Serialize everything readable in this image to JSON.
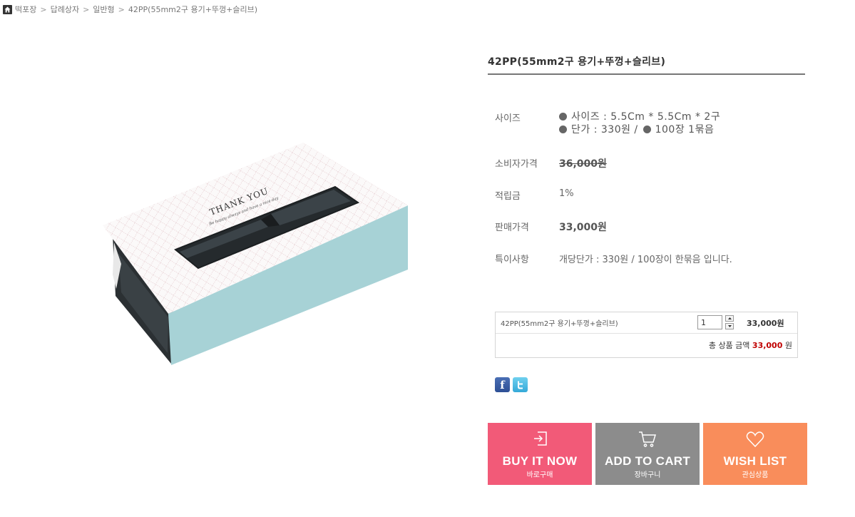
{
  "breadcrumb": {
    "items": [
      "떡포장",
      "답례상자",
      "일반형",
      "42PP(55mm2구 용기+뚜껑+슬리브)"
    ]
  },
  "product": {
    "title": "42PP(55mm2구 용기+뚜껑+슬리브)",
    "image_text": {
      "headline": "THANK YOU",
      "subline": "Be happy always and have a nice day"
    }
  },
  "specs": {
    "size_label": "사이즈",
    "size_line1": "사이즈 : 5.5Cm * 5.5Cm * 2구",
    "size_line2a": "단가 : 330원 /",
    "size_line2b": "100장 1묶음",
    "consumer_price_label": "소비자가격",
    "consumer_price": "36,000원",
    "points_label": "적립금",
    "points": "1%",
    "sale_price_label": "판매가격",
    "sale_price": "33,000원",
    "note_label": "특이사항",
    "note": "개당단가 : 330원 / 100장이 한묶음 입니다."
  },
  "option": {
    "name": "42PP(55mm2구 용기+뚜껑+슬리브)",
    "quantity": "1",
    "price": "33,000원",
    "total_label": "총 상품 금액",
    "total_amount": "33,000",
    "total_unit": "원"
  },
  "social": {
    "facebook_glyph": "f",
    "facebook_icon": "facebook-icon",
    "twitter_icon": "twitter-icon"
  },
  "actions": {
    "buy_label": "BUY IT NOW",
    "buy_sub": "바로구매",
    "cart_label": "ADD TO CART",
    "cart_sub": "장바구니",
    "wish_label": "WISH LIST",
    "wish_sub": "관심상품"
  },
  "colors": {
    "buy": "#f25a78",
    "cart": "#8c8c8c",
    "wish": "#f98d5b",
    "total_amount": "#c00000"
  }
}
